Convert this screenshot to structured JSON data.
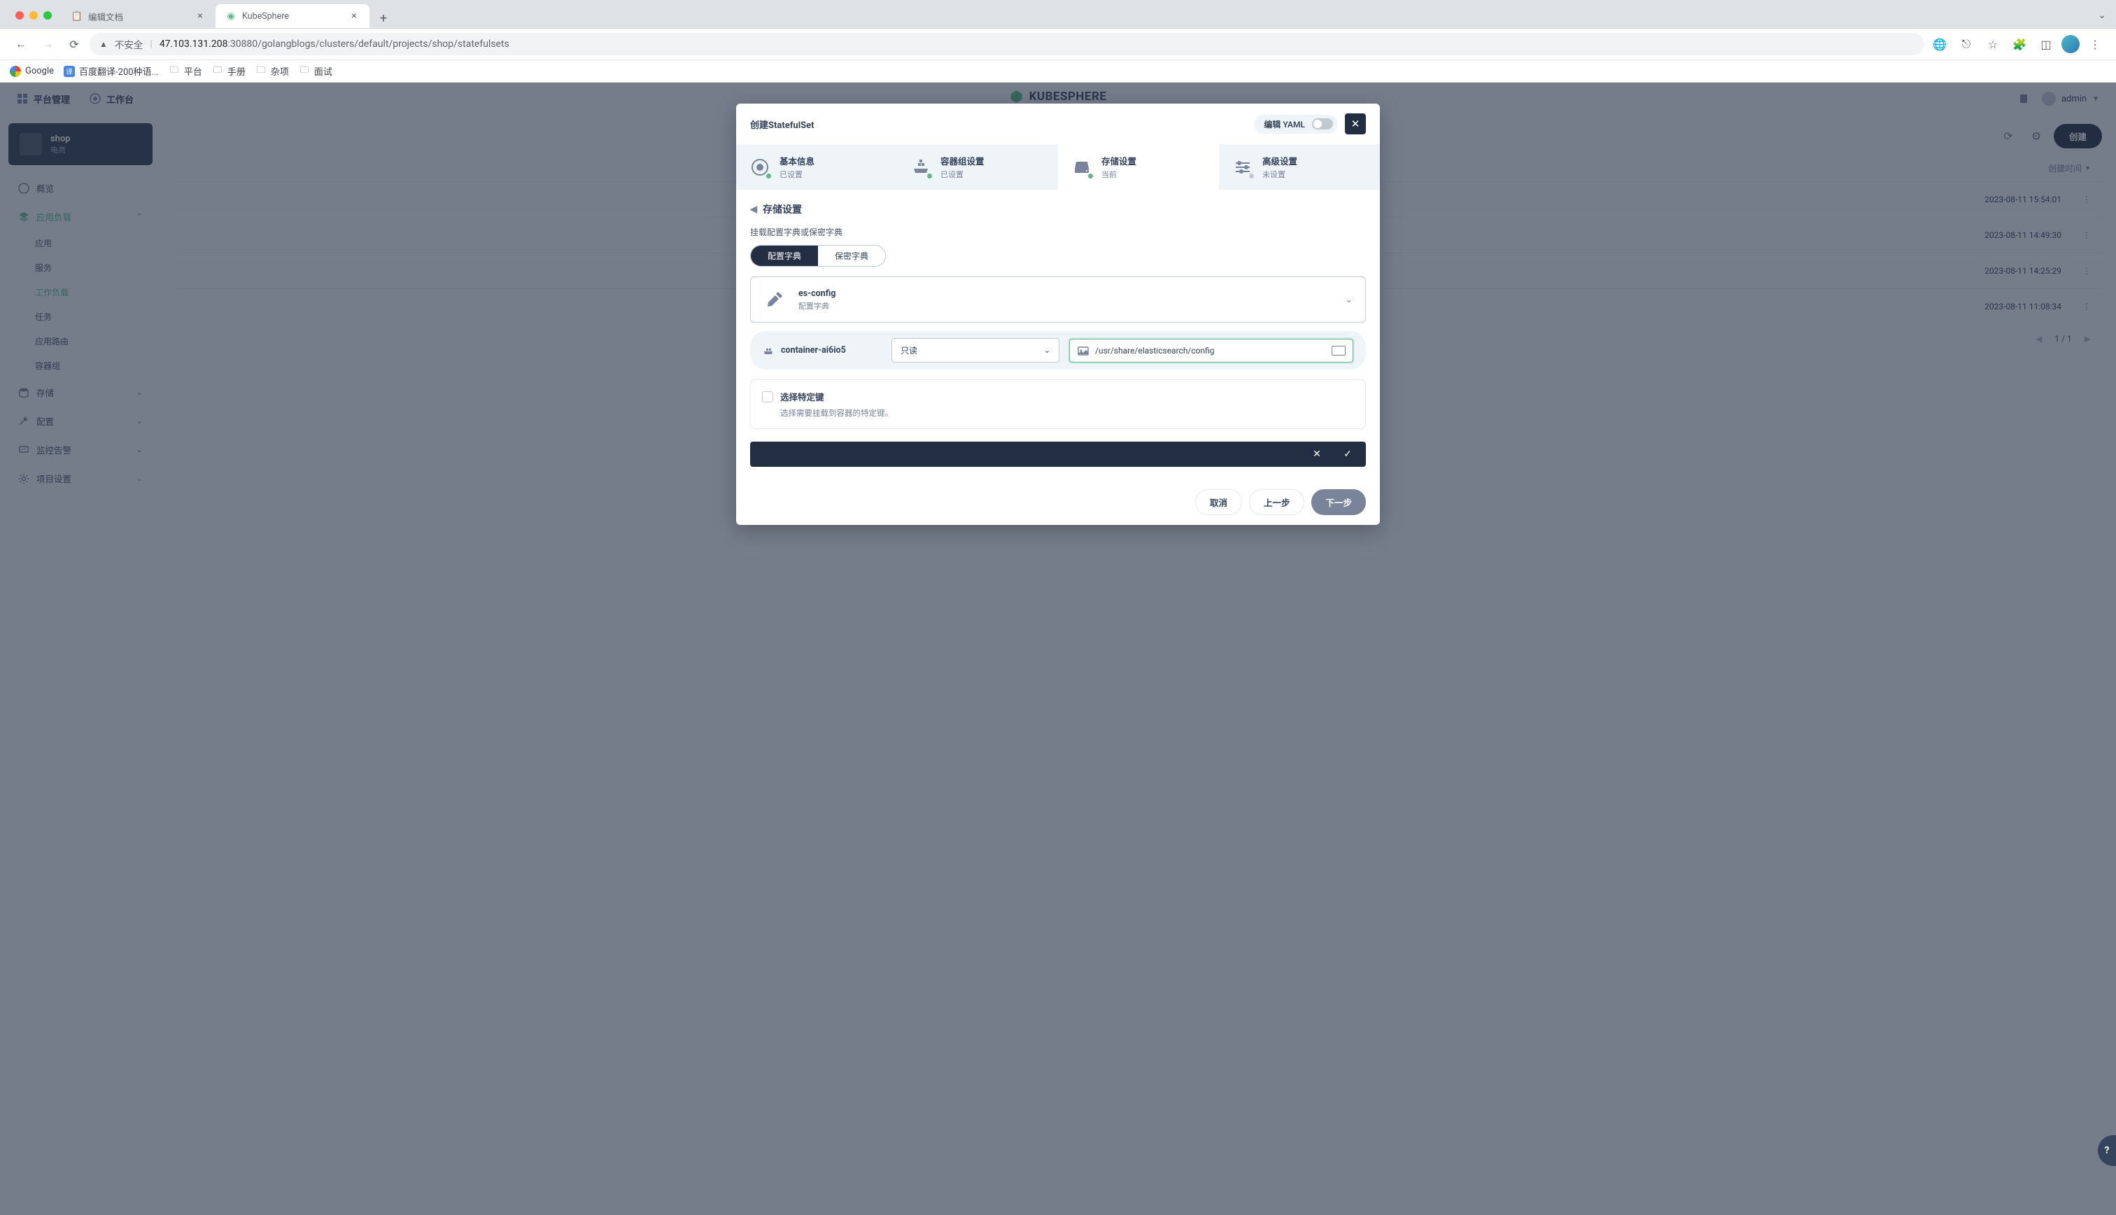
{
  "browser": {
    "tabs": [
      {
        "title": "编辑文档",
        "favicon": "📄",
        "active": false
      },
      {
        "title": "KubeSphere",
        "favicon": "🟢",
        "active": true
      }
    ],
    "url_label": "不安全",
    "url_host": "47.103.131.208",
    "url_port_path": ":30880/golangblogs/clusters/default/projects/shop/statefulsets",
    "bookmarks": [
      {
        "label": "Google",
        "icon_type": "google"
      },
      {
        "label": "百度翻译-200种语...",
        "icon_type": "baidu"
      },
      {
        "label": "平台",
        "icon_type": "folder"
      },
      {
        "label": "手册",
        "icon_type": "folder"
      },
      {
        "label": "杂项",
        "icon_type": "folder"
      },
      {
        "label": "面试",
        "icon_type": "folder"
      }
    ]
  },
  "topbar": {
    "platform": "平台管理",
    "workbench": "工作台",
    "logo": "KUBESPHERE",
    "user": "admin"
  },
  "sidebar": {
    "project_name": "shop",
    "project_sub": "电商",
    "items": [
      {
        "label": "概览",
        "type": "item"
      },
      {
        "label": "应用负载",
        "type": "expand",
        "expanded": true
      },
      {
        "label": "应用",
        "type": "sub"
      },
      {
        "label": "服务",
        "type": "sub"
      },
      {
        "label": "工作负载",
        "type": "sub",
        "active": true
      },
      {
        "label": "任务",
        "type": "sub"
      },
      {
        "label": "应用路由",
        "type": "sub"
      },
      {
        "label": "容器组",
        "type": "sub"
      },
      {
        "label": "存储",
        "type": "expand"
      },
      {
        "label": "配置",
        "type": "expand"
      },
      {
        "label": "监控告警",
        "type": "expand"
      },
      {
        "label": "项目设置",
        "type": "expand"
      }
    ]
  },
  "main": {
    "create_label": "创建",
    "column_time": "创建时间",
    "rows": [
      {
        "time": "2023-08-11 15:54:01"
      },
      {
        "time": "2023-08-11 14:49:30"
      },
      {
        "time": "2023-08-11 14:25:29"
      },
      {
        "time": "2023-08-11 11:08:34"
      }
    ],
    "pagination": "1 / 1"
  },
  "modal": {
    "title": "创建StatefulSet",
    "yaml_label": "编辑 YAML",
    "steps": [
      {
        "title": "基本信息",
        "sub": "已设置",
        "status": "done"
      },
      {
        "title": "容器组设置",
        "sub": "已设置",
        "status": "done"
      },
      {
        "title": "存储设置",
        "sub": "当前",
        "status": "current"
      },
      {
        "title": "高级设置",
        "sub": "未设置",
        "status": "pending"
      }
    ],
    "body_title": "存储设置",
    "section_label": "挂载配置字典或保密字典",
    "pill_config": "配置字典",
    "pill_secret": "保密字典",
    "config_name": "es-config",
    "config_type": "配置字典",
    "container_name": "container-ai6io5",
    "mode_value": "只读",
    "path_value": "/usr/share/elasticsearch/config",
    "keyselect_title": "选择特定键",
    "keyselect_sub": "选择需要挂载到容器的特定键。",
    "btn_cancel": "取消",
    "btn_prev": "上一步",
    "btn_next": "下一步"
  }
}
